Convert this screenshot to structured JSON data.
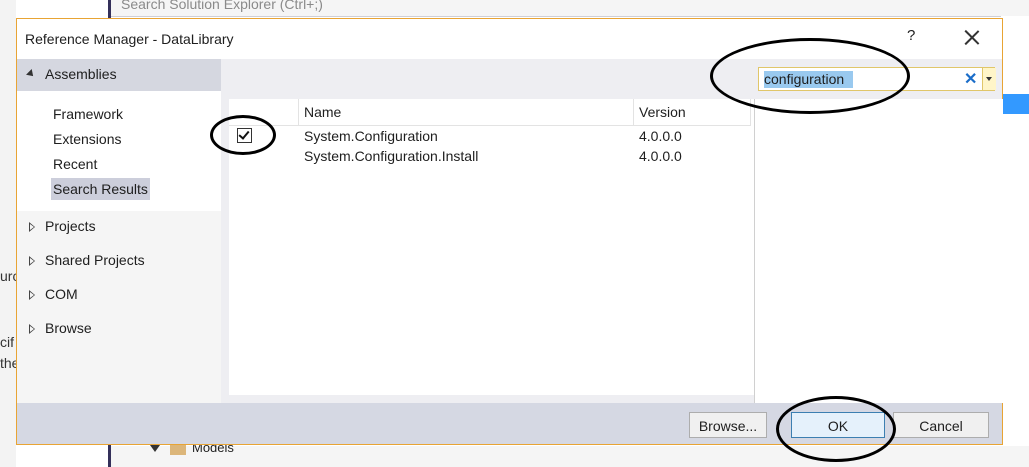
{
  "background": {
    "search_placeholder": "Search Solution Explorer (Ctrl+;)",
    "models_label": "Models",
    "left_fragments": [
      "urc",
      "cif",
      "the"
    ]
  },
  "dialog": {
    "title": "Reference Manager - DataLibrary",
    "help_label": "?",
    "close_icon": "close-icon"
  },
  "nav": {
    "assemblies": {
      "label": "Assemblies",
      "items": [
        {
          "label": "Framework"
        },
        {
          "label": "Extensions"
        },
        {
          "label": "Recent"
        },
        {
          "label": "Search Results"
        }
      ],
      "selected": "Search Results"
    },
    "groups": [
      {
        "label": "Projects"
      },
      {
        "label": "Shared Projects"
      },
      {
        "label": "COM"
      },
      {
        "label": "Browse"
      }
    ]
  },
  "search": {
    "value": "configuration",
    "clear_icon": "clear-icon"
  },
  "grid": {
    "columns": {
      "name": "Name",
      "version": "Version"
    },
    "rows": [
      {
        "name": "System.Configuration",
        "version": "4.0.0.0",
        "checked": true
      },
      {
        "name": "System.Configuration.Install",
        "version": "4.0.0.0",
        "checked": false
      }
    ]
  },
  "footer": {
    "browse_label": "Browse...",
    "ok_label": "OK",
    "cancel_label": "Cancel"
  },
  "colors": {
    "dialog_border": "#e8a434",
    "selection": "#99c9ef",
    "nav_header": "#d5d7e0",
    "footer": "#d5d8e3"
  }
}
